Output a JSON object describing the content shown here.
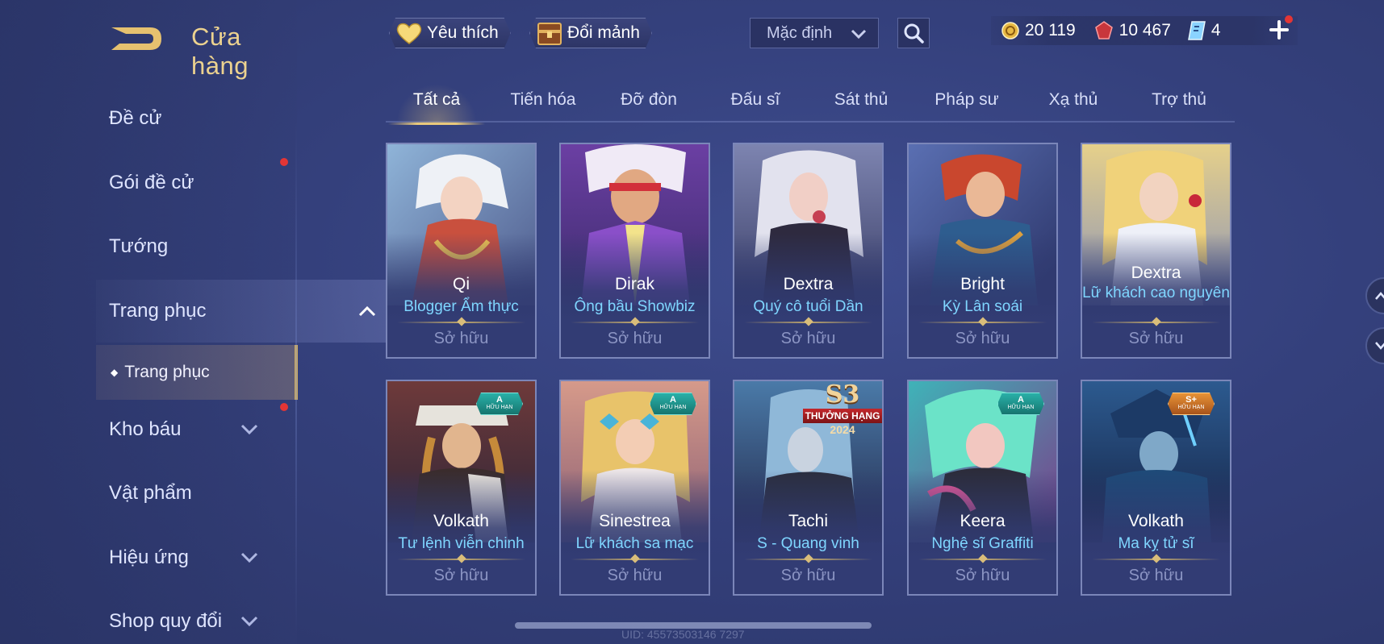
{
  "header": {
    "title": "Cửa hàng",
    "favorite_label": "Yêu thích",
    "exchange_label": "Đổi mảnh",
    "sort_value": "Mặc định"
  },
  "currency": {
    "gold": "20 119",
    "gems": "10 467",
    "vouchers": "4"
  },
  "sidebar": {
    "items": [
      {
        "label": "Đề cử",
        "expandable": false,
        "notify": false
      },
      {
        "label": "Gói đề cử",
        "expandable": false,
        "notify": true
      },
      {
        "label": "Tướng",
        "expandable": false,
        "notify": false
      },
      {
        "label": "Trang phục",
        "expandable": true,
        "expanded": true,
        "active": true
      },
      {
        "label": "Kho báu",
        "expandable": true,
        "notify": true
      },
      {
        "label": "Vật phẩm",
        "expandable": false,
        "notify": false
      },
      {
        "label": "Hiệu ứng",
        "expandable": true,
        "notify": false
      },
      {
        "label": "Shop quy đổi",
        "expandable": true,
        "notify": false
      }
    ],
    "sub_item": "Trang phục"
  },
  "tabs": [
    "Tất cả",
    "Tiến hóa",
    "Đỡ đòn",
    "Đấu sĩ",
    "Sát thủ",
    "Pháp sư",
    "Xạ thủ",
    "Trợ thủ"
  ],
  "active_tab": "Tất cả",
  "cards": [
    {
      "hero": "Qi",
      "skin": "Blogger Ẩm thực",
      "status": "Sở hữu",
      "art": "qi-art"
    },
    {
      "hero": "Dirak",
      "skin": "Ông bầu Showbiz",
      "status": "Sở hữu",
      "art": "dirak-art"
    },
    {
      "hero": "Dextra",
      "skin": "Quý cô tuổi Dần",
      "status": "Sở hữu",
      "art": "dextra-art"
    },
    {
      "hero": "Bright",
      "skin": "Kỳ Lân soái",
      "status": "Sở hữu",
      "art": "bright-art"
    },
    {
      "hero": "Dextra",
      "skin": "Lữ khách cao nguyên",
      "status": "Sở hữu",
      "art": "dextra-2-art"
    },
    {
      "hero": "Volkath",
      "skin": "Tư lệnh viễn chinh",
      "status": "Sở hữu",
      "badge": {
        "tier": "A",
        "text": "HỮU HẠN",
        "color": "#29b0a8"
      }
    },
    {
      "hero": "Sinestrea",
      "skin": "Lữ khách sa mạc",
      "status": "Sở hữu",
      "badge": {
        "tier": "A",
        "text": "HỮU HẠN",
        "color": "#29b0a8"
      }
    },
    {
      "hero": "Tachi",
      "skin": "S - Quang vinh",
      "status": "Sở hữu",
      "season": {
        "title": "S3",
        "rank": "THƯỞNG HẠNG",
        "year": "2024"
      }
    },
    {
      "hero": "Keera",
      "skin": "Nghệ sĩ Graffiti",
      "status": "Sở hữu",
      "badge": {
        "tier": "A",
        "text": "HỮU HẠN",
        "color": "#29b0a8"
      }
    },
    {
      "hero": "Volkath",
      "skin": "Ma kỵ tử sĩ",
      "status": "Sở hữu",
      "badge": {
        "tier": "S+",
        "text": "HỮU HẠN",
        "color": "#e79236"
      }
    }
  ],
  "footer": {
    "uid": "UID: 45573503146 7297"
  },
  "colors": {
    "accent_gold": "#e9c97c",
    "skin_name": "#7fd6ff",
    "notify": "#e33535"
  }
}
